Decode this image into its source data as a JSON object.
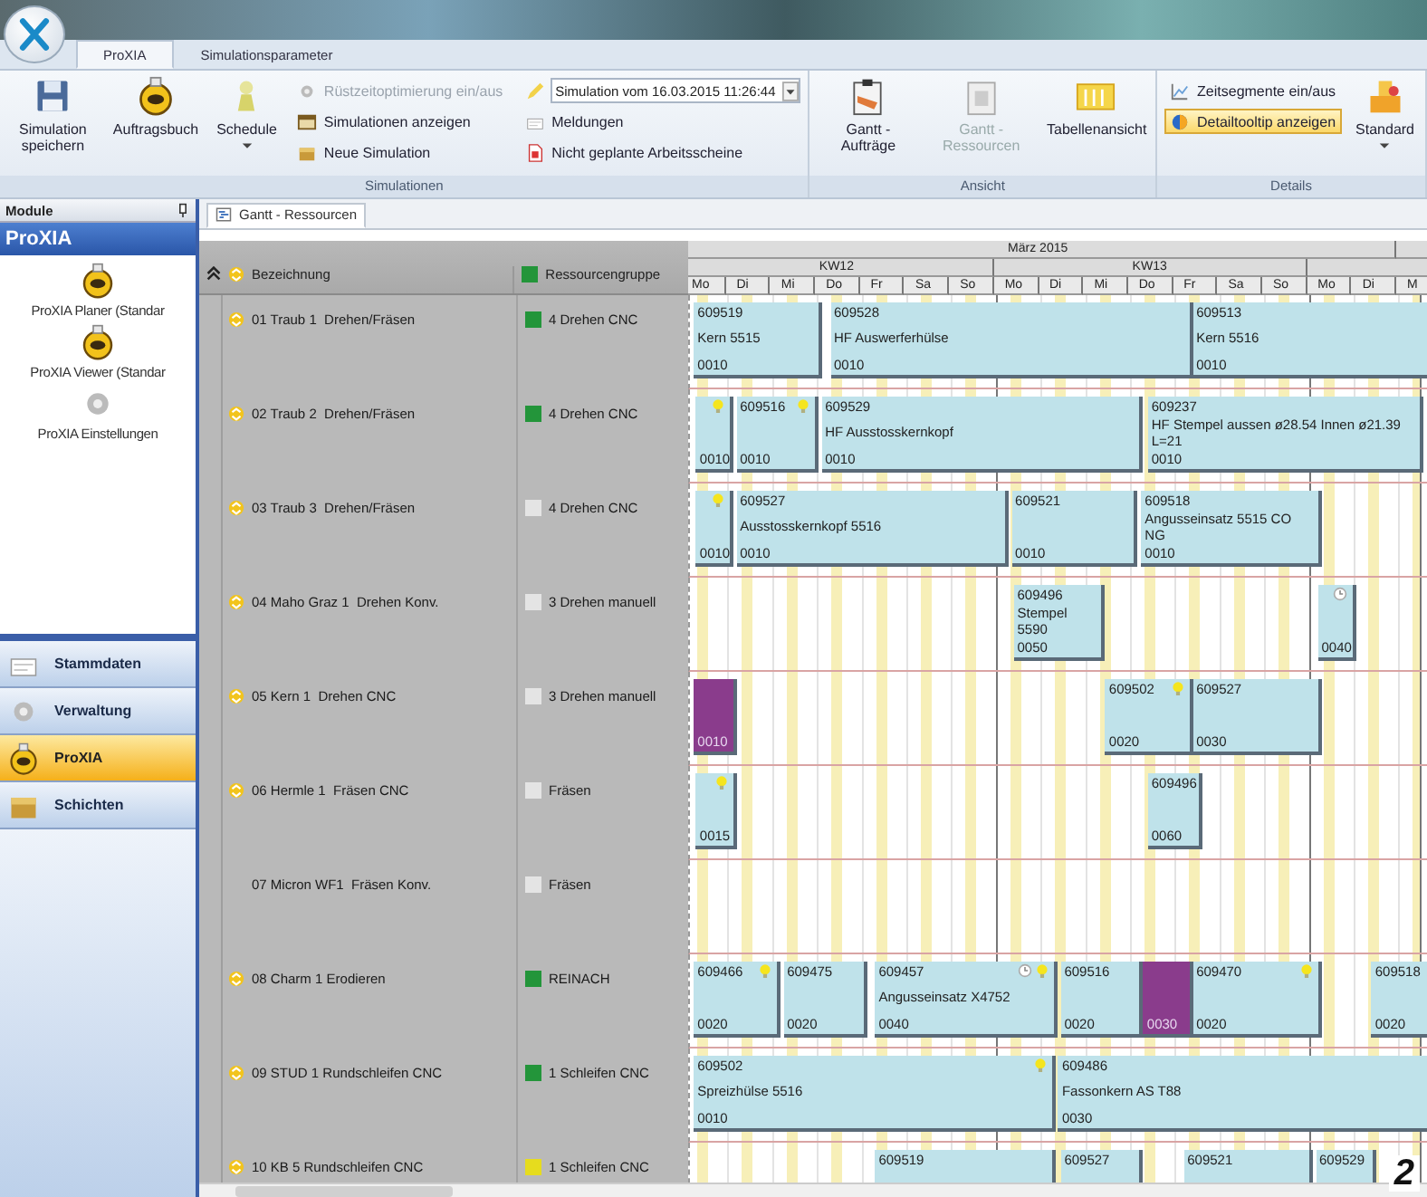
{
  "ribbon_tabs": [
    {
      "label": "ProXIA",
      "selected": true
    },
    {
      "label": "Simulationsparameter",
      "selected": false
    }
  ],
  "ribbon_groups": [
    {
      "title": "Simulationen",
      "controls": [
        {
          "kind": "large",
          "label": "Simulation speichern",
          "dropdown": false,
          "disabled": false
        },
        {
          "kind": "large",
          "label": "Auftragsbuch",
          "dropdown": false,
          "disabled": false
        },
        {
          "kind": "large",
          "label": "Schedule",
          "dropdown": true,
          "disabled": false
        },
        {
          "kind": "column",
          "items": [
            {
              "kind": "small",
              "label": "Rüstzeitoptimierung ein/aus",
              "disabled": true
            },
            {
              "kind": "small",
              "label": "Simulationen anzeigen",
              "disabled": false
            },
            {
              "kind": "small",
              "label": "Neue Simulation",
              "disabled": false
            }
          ]
        },
        {
          "kind": "column",
          "items": [
            {
              "kind": "combo",
              "label": "Simulation vom 16.03.2015 11:26:44",
              "disabled": false
            },
            {
              "kind": "small",
              "label": "Meldungen",
              "disabled": false
            },
            {
              "kind": "small",
              "label": "Nicht geplante Arbeitsscheine",
              "disabled": false
            }
          ]
        }
      ]
    },
    {
      "title": "Ansicht",
      "controls": [
        {
          "kind": "large",
          "label": "Gantt - Aufträge",
          "dropdown": false,
          "disabled": false
        },
        {
          "kind": "large",
          "label": "Gantt - Ressourcen",
          "dropdown": false,
          "disabled": true
        },
        {
          "kind": "large",
          "label": "Tabellenansicht",
          "dropdown": false,
          "disabled": false
        }
      ]
    },
    {
      "title": "Details",
      "controls": [
        {
          "kind": "column",
          "items": [
            {
              "kind": "small",
              "label": "Zeitsegmente ein/aus",
              "disabled": false,
              "selected": false
            },
            {
              "kind": "small",
              "label": "Detailtooltip anzeigen",
              "disabled": false,
              "selected": true
            }
          ]
        },
        {
          "kind": "large",
          "label": "Standard",
          "dropdown": true,
          "disabled": false
        }
      ]
    }
  ],
  "modules_panel": {
    "title": "Module",
    "section": "ProXIA",
    "items": [
      "ProXIA Planer (Standar",
      "ProXIA Viewer (Standar",
      "ProXIA Einstellungen"
    ],
    "nav": [
      {
        "label": "Stammdaten",
        "selected": false
      },
      {
        "label": "Verwaltung",
        "selected": false
      },
      {
        "label": "ProXIA",
        "selected": true
      },
      {
        "label": "Schichten",
        "selected": false
      }
    ]
  },
  "document_tabs": [
    {
      "label": "Gantt - Ressourcen",
      "selected": true
    }
  ],
  "columns": [
    "Bezeichnung",
    "Ressourcengruppe"
  ],
  "timeline": {
    "month": "März 2015",
    "weeks": [
      "KW12",
      "KW13"
    ],
    "days": [
      "Mo",
      "Di",
      "Mi",
      "Do",
      "Fr",
      "Sa",
      "So",
      "Mo",
      "Di",
      "Mi",
      "Do",
      "Fr",
      "Sa",
      "So",
      "Mo",
      "Di",
      "M"
    ]
  },
  "rows": [
    {
      "name": "01 Traub 1  Drehen/Fräsen",
      "expandable": true,
      "group": "4 Drehen CNC",
      "color": "#23953a",
      "bars": [
        {
          "order": "609519",
          "part": "Kern 5515",
          "op": "0010",
          "kind": "task",
          "marked": false,
          "timer": false
        },
        {
          "order": "609528",
          "part": "HF Auswerferhülse",
          "op": "0010",
          "kind": "task",
          "marked": false,
          "timer": false
        },
        {
          "order": "609513",
          "part": "Kern 5516",
          "op": "0010",
          "kind": "task",
          "marked": false,
          "timer": false
        }
      ]
    },
    {
      "name": "02 Traub 2  Drehen/Fräsen",
      "expandable": true,
      "group": "4 Drehen CNC",
      "color": "#23953a",
      "bars": [
        {
          "op": "0010",
          "kind": "task",
          "marked": true,
          "timer": false
        },
        {
          "order": "609516",
          "op": "0010",
          "kind": "task",
          "marked": true,
          "timer": false
        },
        {
          "order": "609529",
          "part": "HF Ausstosskernkopf",
          "op": "0010",
          "kind": "task",
          "marked": false,
          "timer": false
        },
        {
          "order": "609237",
          "part": "HF Stempel aussen ø28.54 Innen ø21.39 L=21",
          "op": "0010",
          "kind": "task",
          "marked": false,
          "timer": false
        }
      ]
    },
    {
      "name": "03 Traub 3  Drehen/Fräsen",
      "expandable": true,
      "group": "4 Drehen CNC",
      "color": "#e4e4e4",
      "bars": [
        {
          "op": "0010",
          "kind": "task",
          "marked": true,
          "timer": false
        },
        {
          "order": "609527",
          "part": "Ausstosskernkopf 5516",
          "op": "0010",
          "kind": "task",
          "marked": false,
          "timer": false
        },
        {
          "order": "609521",
          "op": "0010",
          "kind": "task",
          "marked": false,
          "timer": false
        },
        {
          "order": "609518",
          "part": "Angusseinsatz 5515 CO NG",
          "op": "0010",
          "kind": "task",
          "marked": false,
          "timer": false
        }
      ]
    },
    {
      "name": "04 Maho Graz 1  Drehen Konv.",
      "expandable": true,
      "group": "3 Drehen manuell",
      "color": "#e4e4e4",
      "bars": [
        {
          "order": "609496",
          "part": "Stempel 5590",
          "op": "0050",
          "kind": "task",
          "marked": false,
          "timer": false
        },
        {
          "op": "0040",
          "kind": "task",
          "marked": false,
          "timer": true
        }
      ]
    },
    {
      "name": "05 Kern 1  Drehen CNC",
      "expandable": true,
      "group": "3 Drehen manuell",
      "color": "#e4e4e4",
      "bars": [
        {
          "op": "0010",
          "kind": "setup",
          "marked": false,
          "timer": false
        },
        {
          "order": "609502",
          "op": "0020",
          "kind": "task",
          "marked": true,
          "timer": false
        },
        {
          "order": "609527",
          "op": "0030",
          "kind": "task",
          "marked": false,
          "timer": false
        }
      ]
    },
    {
      "name": "06 Hermle 1  Fräsen CNC",
      "expandable": true,
      "group": "Fräsen",
      "color": "#e4e4e4",
      "bars": [
        {
          "op": "0015",
          "kind": "task",
          "marked": true,
          "timer": false
        },
        {
          "order": "609496",
          "op": "0060",
          "kind": "task",
          "marked": false,
          "timer": false
        }
      ]
    },
    {
      "name": "07 Micron WF1  Fräsen Konv.",
      "expandable": false,
      "group": "Fräsen",
      "color": "#e4e4e4",
      "bars": []
    },
    {
      "name": "08 Charm 1 Erodieren",
      "expandable": true,
      "group": "REINACH",
      "color": "#23953a",
      "bars": [
        {
          "order": "609466",
          "op": "0020",
          "kind": "task",
          "marked": true,
          "timer": false
        },
        {
          "order": "609475",
          "op": "0020",
          "kind": "task",
          "marked": false,
          "timer": false
        },
        {
          "order": "609457",
          "part": "Angusseinsatz X4752",
          "op": "0040",
          "kind": "task",
          "marked": true,
          "timer": true
        },
        {
          "order": "609516",
          "op": "0020",
          "kind": "task",
          "marked": false,
          "timer": false
        },
        {
          "op": "0030",
          "kind": "setup",
          "marked": false,
          "timer": false
        },
        {
          "order": "609470",
          "op": "0020",
          "kind": "task",
          "marked": true,
          "timer": false
        },
        {
          "order": "609518",
          "op": "0020",
          "kind": "task",
          "marked": false,
          "timer": false
        }
      ]
    },
    {
      "name": "09 STUD 1 Rundschleifen CNC",
      "expandable": true,
      "group": "1 Schleifen CNC",
      "color": "#23953a",
      "bars": [
        {
          "order": "609502",
          "part": "Spreizhülse 5516",
          "op": "0010",
          "kind": "task",
          "marked": true,
          "timer": false
        },
        {
          "order": "609486",
          "part": "Fassonkern AS T88",
          "op": "0030",
          "kind": "task",
          "marked": false,
          "timer": false
        }
      ]
    },
    {
      "name": "10 KB 5 Rundschleifen CNC",
      "expandable": true,
      "group": "1 Schleifen CNC",
      "color": "#e6dc1e",
      "bars": [
        {
          "order": "609519",
          "kind": "task",
          "marked": false,
          "timer": false
        },
        {
          "order": "609527",
          "kind": "task",
          "marked": false,
          "timer": false
        },
        {
          "order": "609521",
          "kind": "task",
          "marked": false,
          "timer": false
        },
        {
          "order": "609529",
          "kind": "task",
          "marked": false,
          "timer": false
        }
      ]
    }
  ],
  "figure_number": "2"
}
